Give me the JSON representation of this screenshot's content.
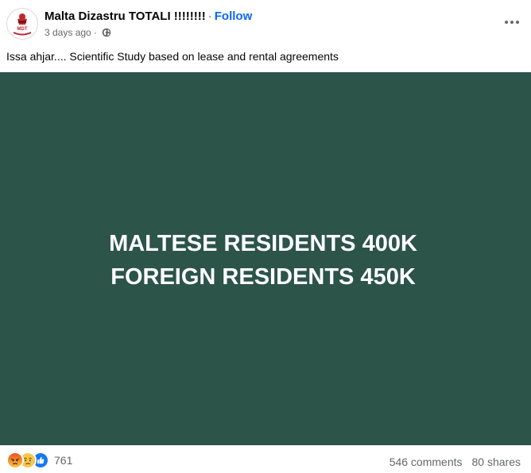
{
  "post": {
    "page_name": "Malta Dizastru TOTALI !!!!!!!!",
    "separator": "·",
    "follow_label": "Follow",
    "time_ago": "3 days ago",
    "meta_separator": "·",
    "caption": "Issa ahjar.... Scientific Study based on lease and rental agreements",
    "image_text_line1": "MALTESE RESIDENTS 400K",
    "image_text_line2": "FOREIGN RESIDENTS 450K",
    "image_background": "#2c5448",
    "avatar_logo_text": "MDT"
  },
  "footer": {
    "reaction_icons": [
      "angry-icon",
      "sad-icon",
      "like-icon"
    ],
    "reaction_count": "761",
    "comments": "546 comments",
    "shares": "80 shares"
  },
  "colors": {
    "link": "#0866ff",
    "secondary_text": "#65676b",
    "primary_text": "#050505"
  }
}
